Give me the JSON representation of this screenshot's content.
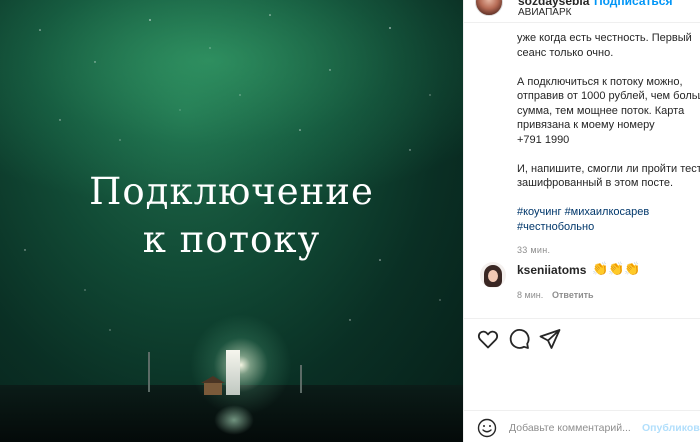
{
  "post": {
    "image_text": [
      "Подключение",
      "к потоку"
    ],
    "author": {
      "username": "sozdaysebia",
      "follow_label": "Подписаться",
      "location": "АВИАПАРК"
    },
    "caption": {
      "paragraphs": [
        "уже когда есть честность. Первый\nсеанс только очно.",
        "А подключиться к потоку можно,\nотправив от 1000 рублей, чем больше\nсумма, тем мощнее поток. Карта\nпривязана к моему номеру\n+791      1990",
        "И, напишите, смогли ли пройти тест\nзашифрованный в этом посте."
      ],
      "hashtags": [
        "#коучинг #михаилкосарев",
        "#честнобольно"
      ],
      "time": "33 мин."
    },
    "comment": {
      "username": "kseniiatoms",
      "emoji_icon": "clapping-hands-icon",
      "emoji": "👏👏👏",
      "time": "8 мин.",
      "reply_label": "Ответить"
    },
    "add_comment": {
      "placeholder": "Добавьте комментарий...",
      "publish_label": "Опубликовать"
    }
  }
}
